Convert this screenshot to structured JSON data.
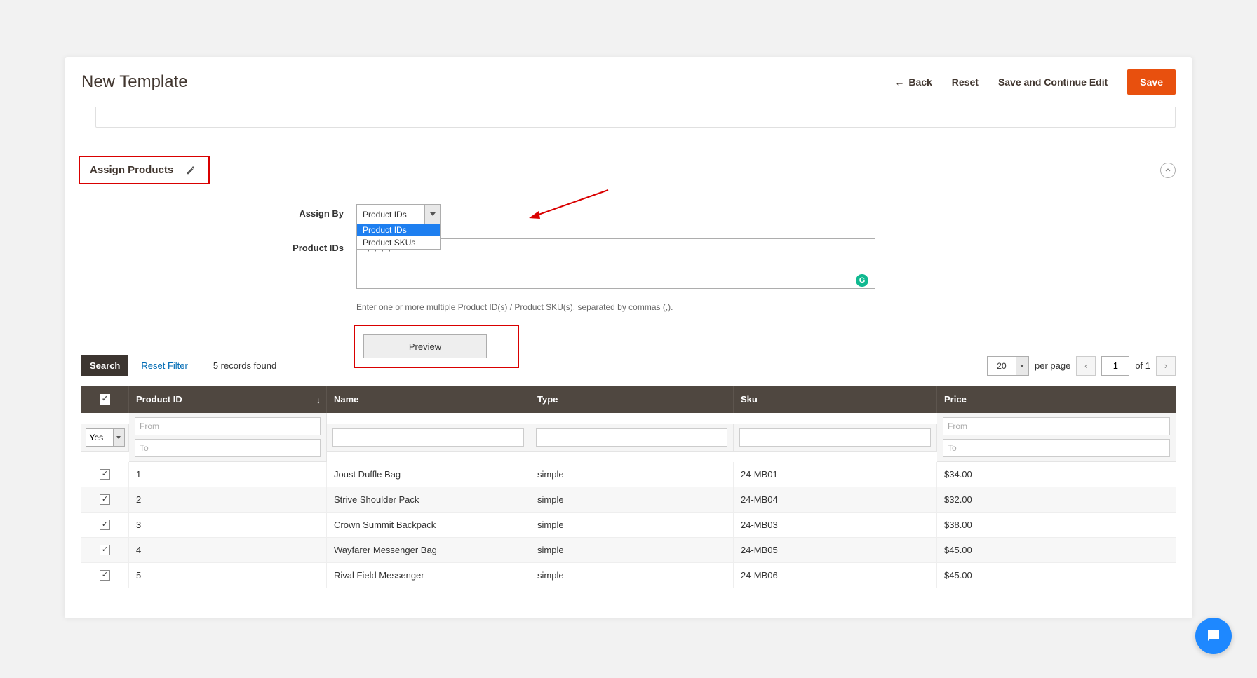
{
  "header": {
    "title": "New Template",
    "back": "Back",
    "reset": "Reset",
    "save_continue": "Save and Continue Edit",
    "save": "Save"
  },
  "section": {
    "title": "Assign Products"
  },
  "form": {
    "assign_by_label": "Assign By",
    "assign_by_value": "Product IDs",
    "assign_by_options": [
      "Product IDs",
      "Product SKUs"
    ],
    "product_ids_label": "Product IDs",
    "product_ids_value": "1,2,3,4,5",
    "help_text": "Enter one or more multiple Product ID(s) / Product SKU(s), separated by commas (,).",
    "preview_label": "Preview"
  },
  "toolbar": {
    "search": "Search",
    "reset_filter": "Reset Filter",
    "records": "5 records found",
    "per_page_value": "20",
    "per_page_label": "per page",
    "page_value": "1",
    "page_of": "of 1"
  },
  "table": {
    "filter_yes": "Yes",
    "filter_from": "From",
    "filter_to": "To",
    "columns": [
      "Product ID",
      "Name",
      "Type",
      "Sku",
      "Price"
    ],
    "rows": [
      {
        "id": "1",
        "name": "Joust Duffle Bag",
        "type": "simple",
        "sku": "24-MB01",
        "price": "$34.00"
      },
      {
        "id": "2",
        "name": "Strive Shoulder Pack",
        "type": "simple",
        "sku": "24-MB04",
        "price": "$32.00"
      },
      {
        "id": "3",
        "name": "Crown Summit Backpack",
        "type": "simple",
        "sku": "24-MB03",
        "price": "$38.00"
      },
      {
        "id": "4",
        "name": "Wayfarer Messenger Bag",
        "type": "simple",
        "sku": "24-MB05",
        "price": "$45.00"
      },
      {
        "id": "5",
        "name": "Rival Field Messenger",
        "type": "simple",
        "sku": "24-MB06",
        "price": "$45.00"
      }
    ]
  }
}
